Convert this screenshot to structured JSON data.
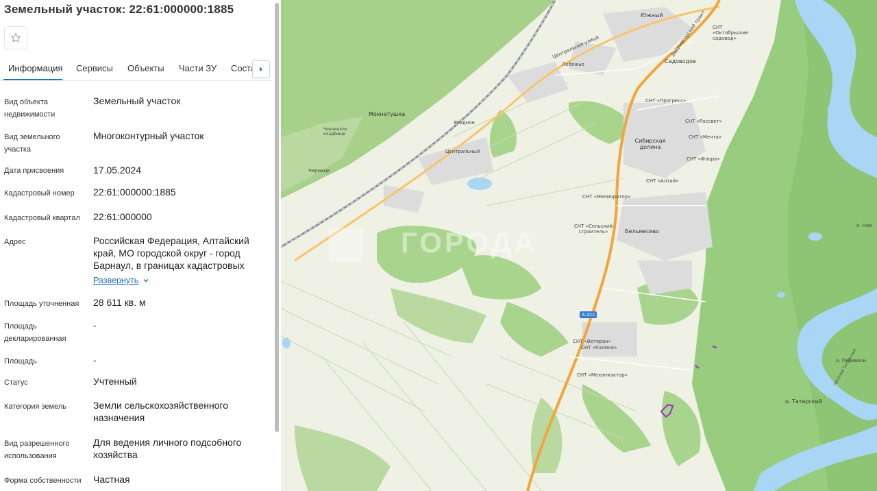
{
  "panel": {
    "title": "Земельный участок: 22:61:000000:1885",
    "tabs": [
      "Информация",
      "Сервисы",
      "Объекты",
      "Части ЗУ",
      "Соста"
    ],
    "active_tab": "Информация",
    "fields": [
      {
        "label": "Вид объекта недвижимости",
        "value": "Земельный участок"
      },
      {
        "label": "Вид земельного участка",
        "value": "Многоконтурный участок"
      },
      {
        "label": "Дата присвоения",
        "value": "17.05.2024"
      },
      {
        "label": "Кадастровый номер",
        "value": "22:61:000000:1885"
      },
      {
        "label": "Кадастровый квартал",
        "value": "22:61:000000"
      },
      {
        "label": "Адрес",
        "value": "Российская Федерация, Алтайский край, МО городской округ - город Барнаул, в границах кадастровых"
      },
      {
        "label": "Площадь уточненная",
        "value": "28 611 кв. м"
      },
      {
        "label": "Площадь декларированная",
        "value": "-"
      },
      {
        "label": "Площадь",
        "value": "-"
      },
      {
        "label": "Статус",
        "value": "Учтенный"
      },
      {
        "label": "Категория земель",
        "value": "Земли сельскохозяйственного назначения"
      },
      {
        "label": "Вид разрешенного использования",
        "value": "Для ведения личного подсобного хозяйства"
      },
      {
        "label": "Форма собственности",
        "value": "Частная"
      }
    ],
    "expand_label": "Развернуть"
  },
  "map": {
    "watermark": "ГОРОДА",
    "highway": "А-322",
    "labels": {
      "yuzhny": "Южный",
      "sadovody": "Садоводов",
      "snt_oktyabrskie": "СНТ «Октябрьские садовод»",
      "central_street": "Центральная улица",
      "lebyazhe": "Лебяжье",
      "mokhnatushka": "Мохнатушка",
      "yagodnoe": "Ягодное",
      "centralny": "Центральный",
      "chernitsk": "Черницк",
      "chernitsk_cemetery": "Черницкое кладбище",
      "snt_progress": "СНТ «Прогресс»",
      "snt_rassvet": "СНТ «Рассвет»",
      "snt_mechta": "СНТ «Мечта»",
      "sibirskaya_dolina": "Сибирская долина",
      "snt_flora": "СНТ «Флора»",
      "snt_altai": "СНТ «Алтай»",
      "snt_meliorator": "СНТ «Мелиоратор»",
      "snt_selskiy": "СНТ «Сельский строитель»",
      "belmesevo": "Бельмесево",
      "snt_veteran": "СНТ «Ветеран»",
      "snt_kalina": "СНТ «Калина»",
      "snt_mekhanizator": "СНТ «Механизатор»",
      "o_tatarsky": "о. Татарский",
      "o_perevoch": "о. Перевочн",
      "o_nev": "о. Нев",
      "zmeinogorsky": "Змеиногорский тракт",
      "protoka": "протока Татарская"
    },
    "colors": {
      "forest": "#a9d48e",
      "forest_dark": "#86c26f",
      "field": "#e6edd6",
      "water": "#a8d4f5",
      "road": "#f5a53b",
      "parcel": "#9b2fc9"
    }
  }
}
